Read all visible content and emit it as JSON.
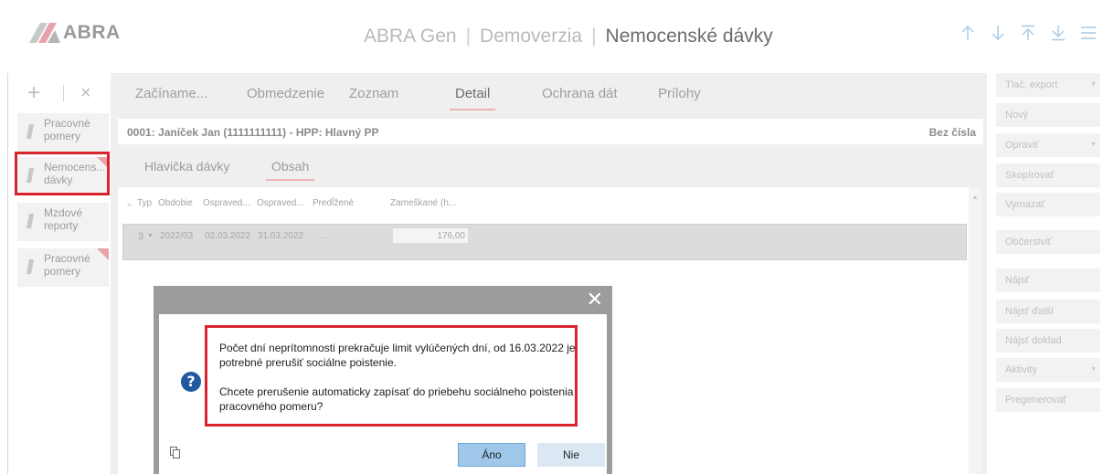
{
  "header": {
    "logo_text": "ABRA",
    "app_name": "ABRA Gen",
    "edition": "Demoverzia",
    "module": "Nemocenské dávky",
    "nav_icons": [
      "arrow-up-icon",
      "arrow-down-icon",
      "arrow-to-top-icon",
      "arrow-to-bottom-icon",
      "hamburger-menu-icon"
    ]
  },
  "sidebar": {
    "add_symbol": "+",
    "delete_symbol": "×",
    "items": [
      {
        "label": "Pracovné\npomery",
        "flag": false
      },
      {
        "label": "Nemocens...\ndávky",
        "flag": true,
        "highlighted": true
      },
      {
        "label": "Mzdové\nreporty",
        "flag": false
      },
      {
        "label": "Pracovné\npomery",
        "flag": true
      }
    ]
  },
  "tabs": [
    {
      "label": "Začíname...",
      "active": false
    },
    {
      "label": "Obmedzenie",
      "active": false
    },
    {
      "label": "Zoznam",
      "active": false
    },
    {
      "label": "Detail",
      "active": true
    },
    {
      "label": "Ochrana dát",
      "active": false
    },
    {
      "label": "Prílohy",
      "active": false
    }
  ],
  "record": {
    "title": "0001: Janíček Jan (1111111111) - HPP: Hlavný PP",
    "number_status": "Bez čísla"
  },
  "subtabs": [
    {
      "label": "Hlavička dávky",
      "active": false
    },
    {
      "label": "Obsah",
      "active": true
    }
  ],
  "grid": {
    "columns": [
      "Typ",
      "Obdobie",
      "Ospraved...",
      "Ospraved...",
      "Predĺžené",
      "Zameškané (h..."
    ],
    "rows": [
      {
        "typ": "3",
        "obdobie": "2022/03",
        "od": "02.03.2022",
        "do": "31.03.2022",
        "predlzene": ". .",
        "zameskane": "176,00"
      }
    ]
  },
  "actions": [
    {
      "label": "Tlač, export",
      "dropdown": true
    },
    {
      "label": "Nový",
      "dropdown": false
    },
    {
      "label": "Opraviť",
      "dropdown": true
    },
    {
      "label": "Skopírovať",
      "dropdown": false
    },
    {
      "label": "Vymazať",
      "dropdown": false
    },
    {
      "label": "Občerstviť",
      "dropdown": false
    },
    {
      "label": "Nájsť",
      "dropdown": false
    },
    {
      "label": "Nájsť ďalší",
      "dropdown": false
    },
    {
      "label": "Nájsť doklad",
      "dropdown": false
    },
    {
      "label": "Aktivity",
      "dropdown": true
    },
    {
      "label": "Pregenerovať",
      "dropdown": false
    }
  ],
  "dialog": {
    "close_symbol": "✕",
    "question_mark": "?",
    "message_line1": "Počet dní neprítomnosti prekračuje limit vylúčených dní, od 16.03.2022 je potrebné prerušiť sociálne poistenie.",
    "message_line2": "Chcete prerušenie automaticky zapísať do priebehu sociálneho poistenia pracovného pomeru?",
    "yes_label": "Áno",
    "no_label": "Nie"
  },
  "colors": {
    "highlight_red": "#d9232d",
    "accent_pink": "#ecb4b8",
    "question_icon_blue": "#1f5aa0",
    "primary_button": "#9ec7ea"
  }
}
